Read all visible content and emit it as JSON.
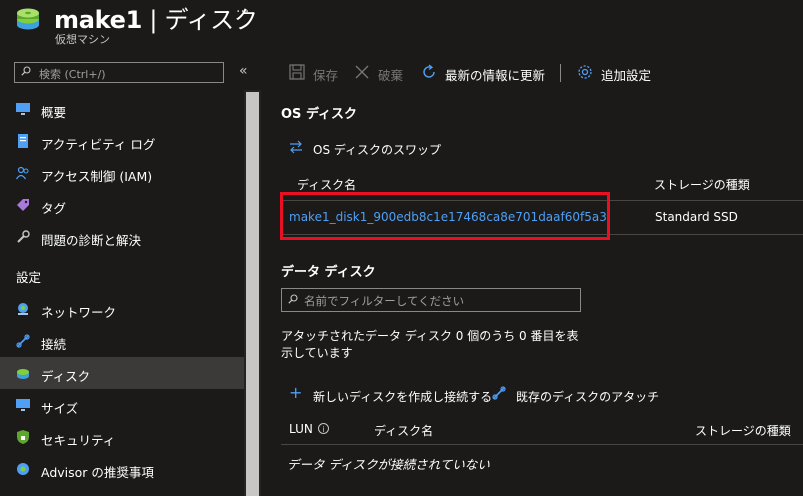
{
  "header": {
    "title_name": "make1",
    "title_sep": " | ",
    "title_section": "ディスク",
    "ellipsis": "···",
    "subtitle": "仮想マシン"
  },
  "sidebar": {
    "search_placeholder": "検索 (Ctrl+/)",
    "collapse": "«",
    "section_label": "設定",
    "items_top": [
      {
        "label": "概要",
        "icon": "monitor-icon"
      },
      {
        "label": "アクティビティ ログ",
        "icon": "activity-log-icon"
      },
      {
        "label": "アクセス制御 (IAM)",
        "icon": "people-icon"
      },
      {
        "label": "タグ",
        "icon": "tag-icon"
      },
      {
        "label": "問題の診断と解決",
        "icon": "wrench-icon"
      }
    ],
    "items_settings": [
      {
        "label": "ネットワーク",
        "icon": "network-icon"
      },
      {
        "label": "接続",
        "icon": "connect-icon"
      },
      {
        "label": "ディスク",
        "icon": "disk-icon",
        "selected": true
      },
      {
        "label": "サイズ",
        "icon": "monitor-icon"
      },
      {
        "label": "セキュリティ",
        "icon": "shield-icon"
      },
      {
        "label": "Advisor の推奨事項",
        "icon": "advisor-icon"
      }
    ]
  },
  "toolbar": {
    "save": "保存",
    "discard": "破棄",
    "refresh": "最新の情報に更新",
    "add_settings": "追加設定"
  },
  "os_disk": {
    "title": "OS ディスク",
    "swap": "OS ディスクのスワップ",
    "col_name": "ディスク名",
    "col_storage": "ストレージの種類",
    "disk_name": "make1_disk1_900edb8c1e17468ca8e701daaf60f5a3",
    "storage_type": "Standard SSD"
  },
  "data_disks": {
    "title": "データ ディスク",
    "filter_placeholder": "名前でフィルターしてください",
    "summary": "アタッチされたデータ ディスク 0 個のうち 0 番目を表示しています",
    "create": "新しいディスクを作成し接続する",
    "attach": "既存のディスクのアタッチ",
    "col_lun": "LUN",
    "col_name": "ディスク名",
    "col_storage": "ストレージの種類",
    "empty": "データ ディスクが接続されていない"
  },
  "colors": {
    "accent": "#4f9ff5",
    "highlight": "#e81123",
    "background": "#1b1a19",
    "selected": "#3b3a39"
  }
}
